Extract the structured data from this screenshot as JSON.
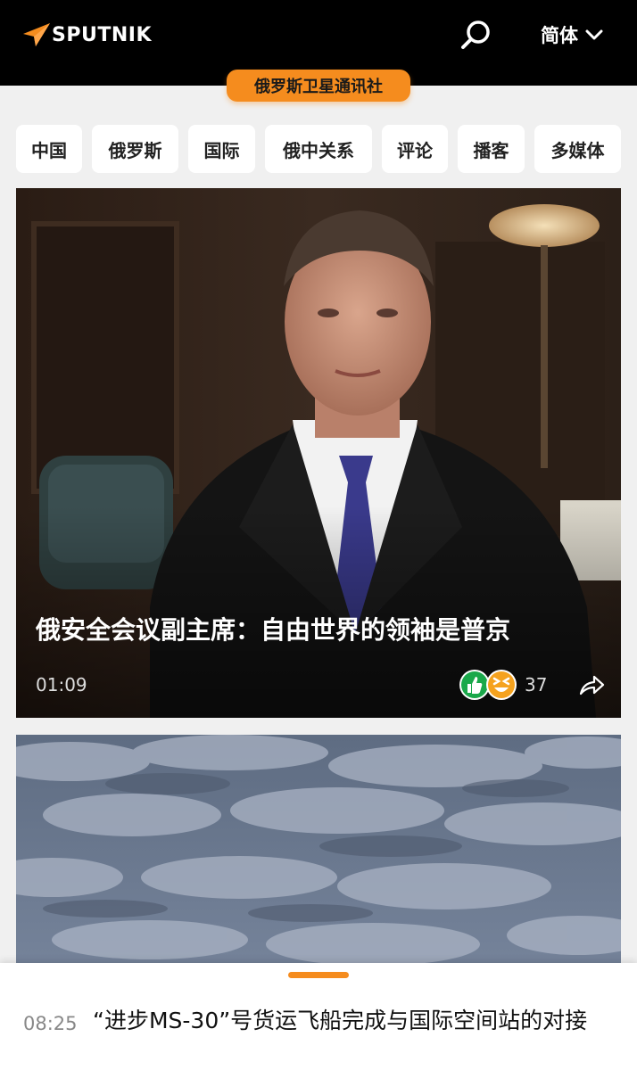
{
  "header": {
    "logo_text": "SPUTNIK",
    "language_label": "简体",
    "icons": [
      "sputnik-logo-icon",
      "search-icon",
      "chevron-down-icon"
    ]
  },
  "agency_label": "俄罗斯卫星通讯社",
  "nav": {
    "items": [
      {
        "label": "中国"
      },
      {
        "label": "俄罗斯"
      },
      {
        "label": "国际"
      },
      {
        "label": "俄中关系"
      },
      {
        "label": "评论"
      },
      {
        "label": "播客"
      },
      {
        "label": "多媒体"
      }
    ]
  },
  "featured": {
    "title": "俄安全会议副主席：自由世界的领袖是普京",
    "time": "01:09",
    "reactions_count": "37",
    "icons": [
      "thumbs-up-icon",
      "laughing-emoji-icon",
      "share-icon"
    ]
  },
  "ticker": {
    "time": "08:25",
    "title": "“进步MS-30”号货运飞船完成与国际空间站的对接"
  },
  "colors": {
    "accent": "#f58c1e",
    "header_bg": "#000000",
    "page_bg": "#f0f0f0",
    "reaction_green": "#1aa84a",
    "reaction_orange": "#f5a21e"
  }
}
